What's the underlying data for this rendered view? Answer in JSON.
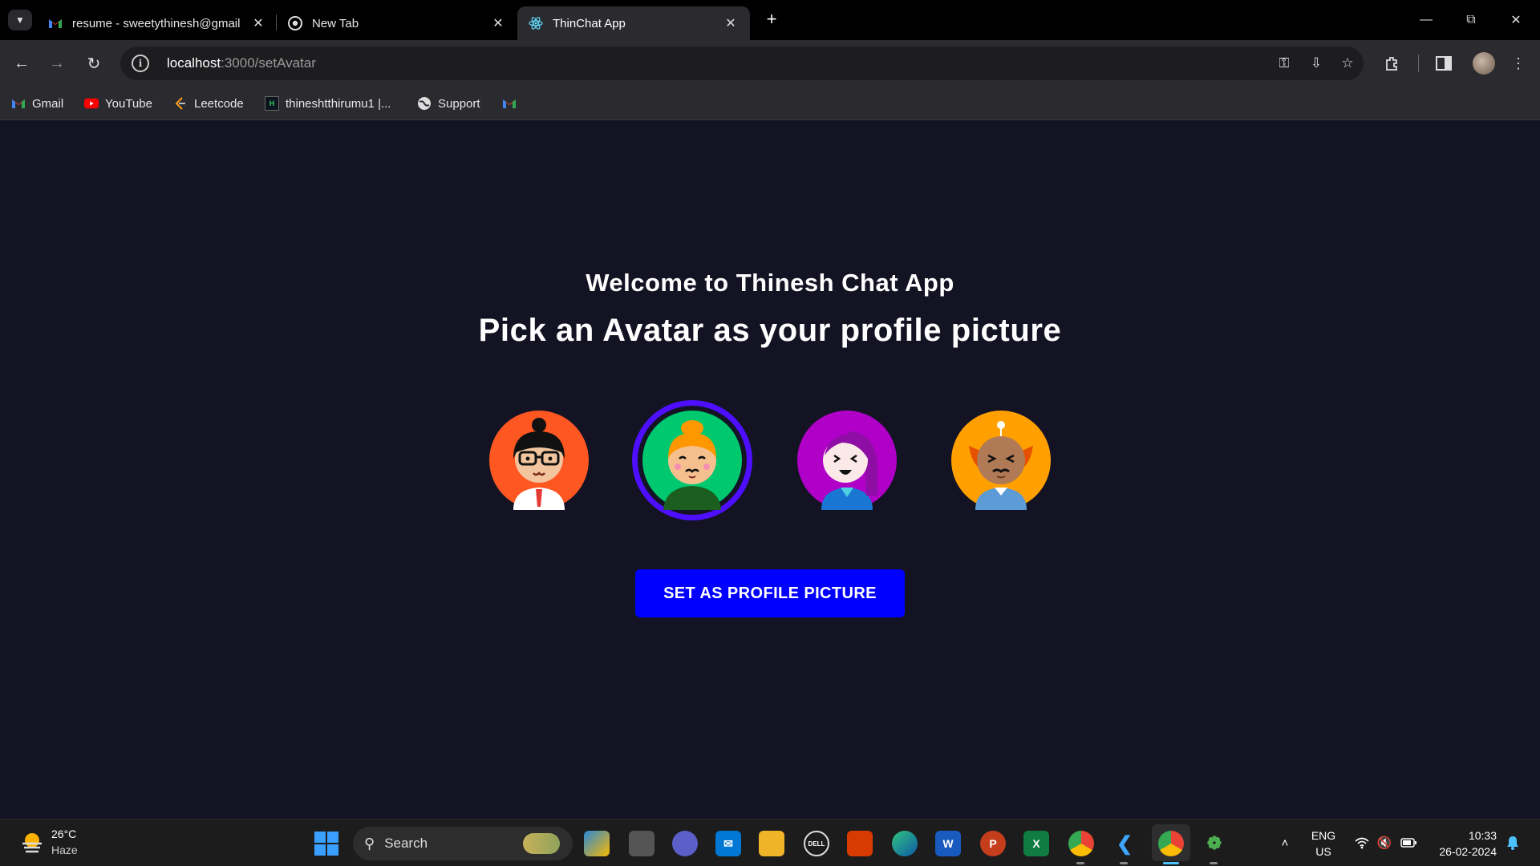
{
  "browser": {
    "tabs": [
      {
        "title": "resume - sweetythinesh@gmail",
        "favicon": "gmail-icon",
        "active": false
      },
      {
        "title": "New Tab",
        "favicon": "chrome-icon",
        "active": false
      },
      {
        "title": "ThinChat App",
        "favicon": "react-icon",
        "active": true
      }
    ],
    "url_host": "localhost",
    "url_path": ":3000/setAvatar",
    "bookmarks": [
      {
        "label": "Gmail",
        "icon": "gmail-icon"
      },
      {
        "label": "YouTube",
        "icon": "youtube-icon"
      },
      {
        "label": "Leetcode",
        "icon": "leetcode-icon"
      },
      {
        "label": "thineshtthirumu1 |...",
        "icon": "hackerrank-icon"
      },
      {
        "label": "Support",
        "icon": "globe-icon"
      },
      {
        "label": "",
        "icon": "gmail-icon"
      }
    ]
  },
  "page": {
    "welcome": "Welcome to Thinesh Chat App",
    "heading": "Pick an Avatar as your profile picture",
    "avatars": [
      {
        "name": "avatar-glasses",
        "bg": "#ff5722",
        "selected": false
      },
      {
        "name": "avatar-bun",
        "bg": "#00c86f",
        "selected": true
      },
      {
        "name": "avatar-purple-hair",
        "bg": "#b000c8",
        "selected": false
      },
      {
        "name": "avatar-devil",
        "bg": "#ffa000",
        "selected": false
      }
    ],
    "set_button": "SET AS PROFILE PICTURE",
    "colors": {
      "background": "#131324",
      "button": "#0000ff",
      "selected_ring": "#4e0eff"
    }
  },
  "taskbar": {
    "weather_temp": "26°C",
    "weather_desc": "Haze",
    "search_placeholder": "Search",
    "lang_top": "ENG",
    "lang_bottom": "US",
    "time": "10:33",
    "date": "26-02-2024"
  }
}
